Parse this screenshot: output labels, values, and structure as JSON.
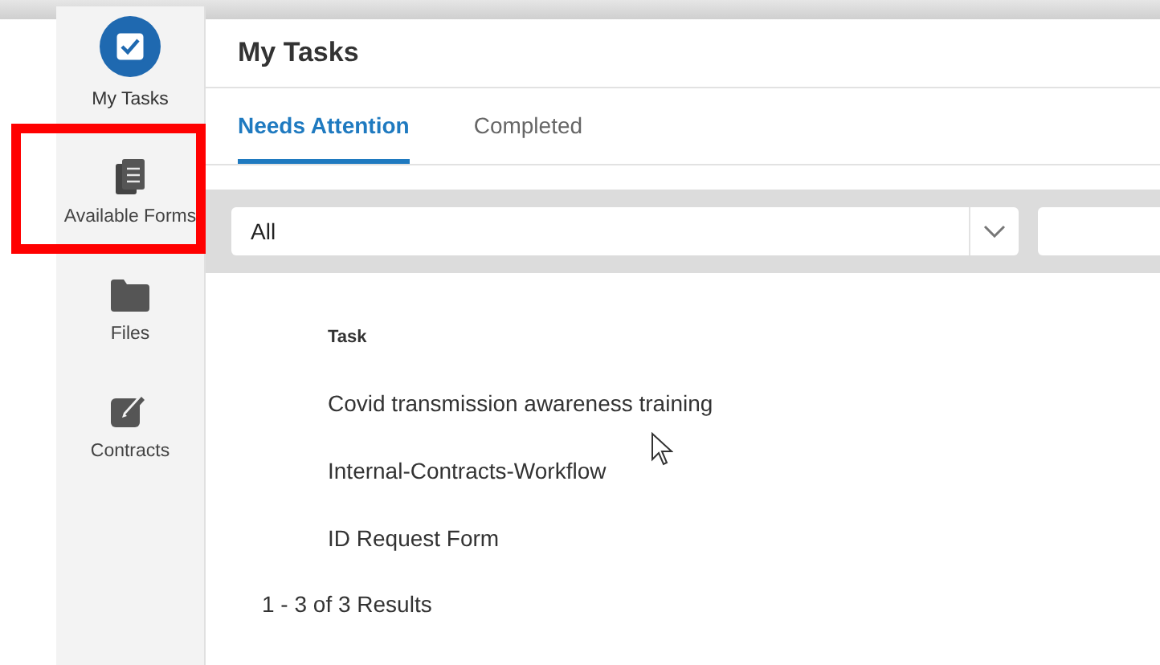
{
  "sidebar": {
    "items": [
      {
        "kind": "tasks",
        "label": "My Tasks",
        "selected": true,
        "highlighted": false
      },
      {
        "kind": "forms",
        "label": "Available Forms",
        "selected": false,
        "highlighted": true
      },
      {
        "kind": "files",
        "label": "Files",
        "selected": false,
        "highlighted": false
      },
      {
        "kind": "contracts",
        "label": "Contracts",
        "selected": false,
        "highlighted": false
      }
    ]
  },
  "header": {
    "title": "My Tasks"
  },
  "tabs": [
    {
      "label": "Needs Attention",
      "selected": true
    },
    {
      "label": "Completed",
      "selected": false
    }
  ],
  "filter": {
    "value": "All"
  },
  "table": {
    "columns": [
      "Task"
    ],
    "rows": [
      [
        "Covid transmission awareness training"
      ],
      [
        "Internal-Contracts-Workflow"
      ],
      [
        "ID Request Form"
      ]
    ]
  },
  "pagination": {
    "summary": "1 - 3 of 3 Results"
  }
}
